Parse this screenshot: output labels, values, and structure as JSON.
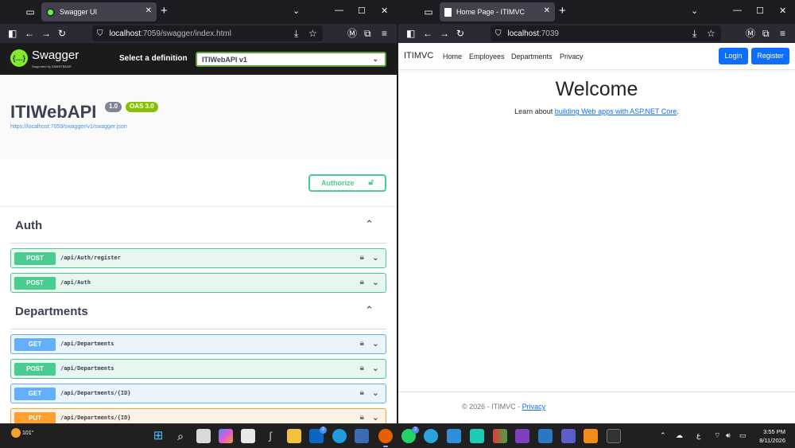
{
  "left_window": {
    "tab_title": "Swagger UI",
    "url_host": "localhost",
    "url_path": ":7059/swagger/index.html",
    "swagger": {
      "brand": "Swagger",
      "brand_sub": "Supported by SMARTBEAR",
      "select_label": "Select a definition",
      "selected_definition": "ITIWebAPI v1",
      "api_title": "ITIWebAPI",
      "version_badge": "1.0",
      "oas_badge": "OAS 3.0",
      "spec_link": "https://localhost:7059/swagger/v1/swagger.json",
      "authorize_label": "Authorize",
      "groups": [
        {
          "name": "Auth",
          "operations": [
            {
              "method": "POST",
              "path": "/api/Auth/register"
            },
            {
              "method": "POST",
              "path": "/api/Auth"
            }
          ]
        },
        {
          "name": "Departments",
          "operations": [
            {
              "method": "GET",
              "path": "/api/Departments"
            },
            {
              "method": "POST",
              "path": "/api/Departments"
            },
            {
              "method": "GET",
              "path": "/api/Departments/{ID}"
            },
            {
              "method": "PUT",
              "path": "/api/Departments/{ID}"
            }
          ]
        }
      ]
    }
  },
  "right_window": {
    "tab_title": "Home Page - ITIMVC",
    "url_host": "localhost",
    "url_path": ":7039",
    "mvc": {
      "brand": "ITIMVC",
      "nav_links": [
        "Home",
        "Employees",
        "Departments",
        "Privacy"
      ],
      "login_label": "Login",
      "register_label": "Register",
      "welcome": "Welcome",
      "learn_prefix": "Learn about ",
      "learn_link": "building Web apps with ASP.NET Core",
      "learn_suffix": ".",
      "footer_text": "© 2026 - ITIMVC - ",
      "footer_link": "Privacy"
    }
  },
  "taskbar": {
    "weather_temp": "101°",
    "time": "3:55 PM",
    "date": "8/11/2026",
    "badges": {
      "linkedin": "2",
      "whatsapp": "2"
    },
    "colors": {
      "accent": "#4c8df6",
      "swagger_green": "#85ea2d",
      "post": "#49cc90",
      "get": "#61affe",
      "put": "#fca130"
    }
  }
}
